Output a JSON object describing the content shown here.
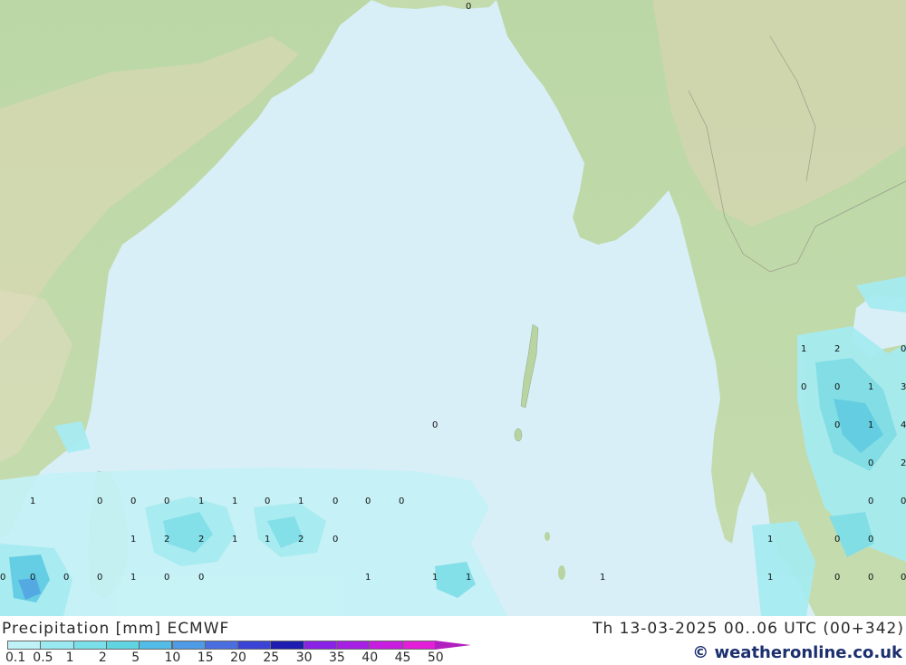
{
  "footer": {
    "title": "Precipitation [mm] ECMWF",
    "datetime": "Th 13-03-2025 00..06 UTC (00+342)",
    "credit": "© weatheronline.co.uk"
  },
  "scale": {
    "labels": [
      "0.1",
      "0.5",
      "1",
      "2",
      "5",
      "10",
      "15",
      "20",
      "25",
      "30",
      "35",
      "40",
      "45",
      "50"
    ],
    "colors": [
      "#bff2f7",
      "#9ae9f0",
      "#7adfe8",
      "#60d4e0",
      "#52bce6",
      "#4f9ae4",
      "#4a6ee0",
      "#3b43d6",
      "#1d1bb0",
      "#8a22e6",
      "#a61fe4",
      "#c81ee0",
      "#e21ed8",
      "#b21fbf"
    ]
  },
  "grid_labels": [
    "1",
    "0",
    "0",
    "0",
    "1",
    "1",
    "0",
    "1",
    "0",
    "0",
    "0",
    "1",
    "2",
    "2",
    "1",
    "1",
    "2",
    "0",
    "0",
    "0",
    "0",
    "0",
    "1",
    "0",
    "0",
    "1",
    "1",
    "1",
    "1",
    "0",
    "1",
    "2",
    "0",
    "0",
    "0",
    "1",
    "3",
    "0",
    "1",
    "4",
    "0",
    "2",
    "0",
    "0",
    "1",
    "0",
    "0",
    "1",
    "0",
    "0",
    "0",
    "0"
  ]
}
